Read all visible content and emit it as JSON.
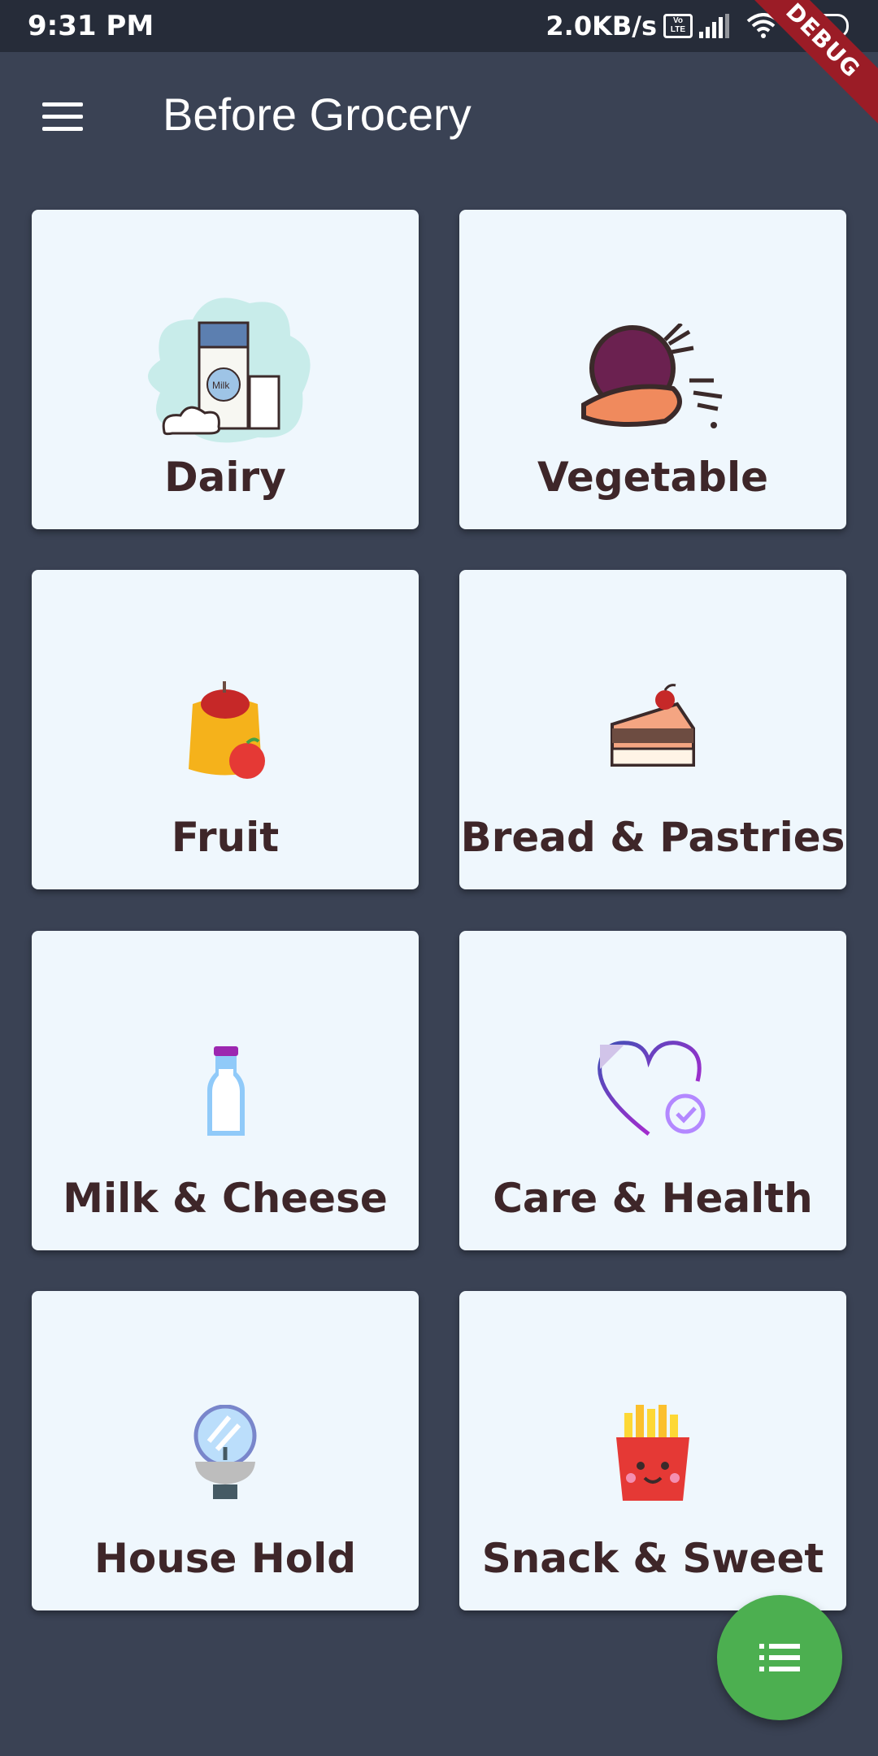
{
  "status_bar": {
    "time": "9:31 PM",
    "net_speed": "2.0KB/s",
    "volte": "Vo LTE",
    "battery": "88",
    "debug_banner": "DEBUG"
  },
  "app_bar": {
    "title": "Before Grocery",
    "menu_icon": "hamburger-menu-icon"
  },
  "categories": [
    {
      "label": "Dairy",
      "icon": "milk-carton-icon"
    },
    {
      "label": "Vegetable",
      "icon": "beetroot-carrot-icon"
    },
    {
      "label": "Fruit",
      "icon": "fruit-bag-icon"
    },
    {
      "label": "Bread & Pastries",
      "icon": "cake-slice-icon"
    },
    {
      "label": "Milk & Cheese",
      "icon": "milk-bottle-icon"
    },
    {
      "label": "Care & Health",
      "icon": "heart-check-icon"
    },
    {
      "label": "House Hold",
      "icon": "sink-mirror-icon"
    },
    {
      "label": "Snack & Sweet",
      "icon": "french-fries-icon"
    }
  ],
  "fab": {
    "icon": "list-icon",
    "color": "#4caf50"
  },
  "colors": {
    "background": "#3a4254",
    "card": "#eff7fd",
    "label": "#3e2629",
    "status_bar": "#262c39"
  }
}
